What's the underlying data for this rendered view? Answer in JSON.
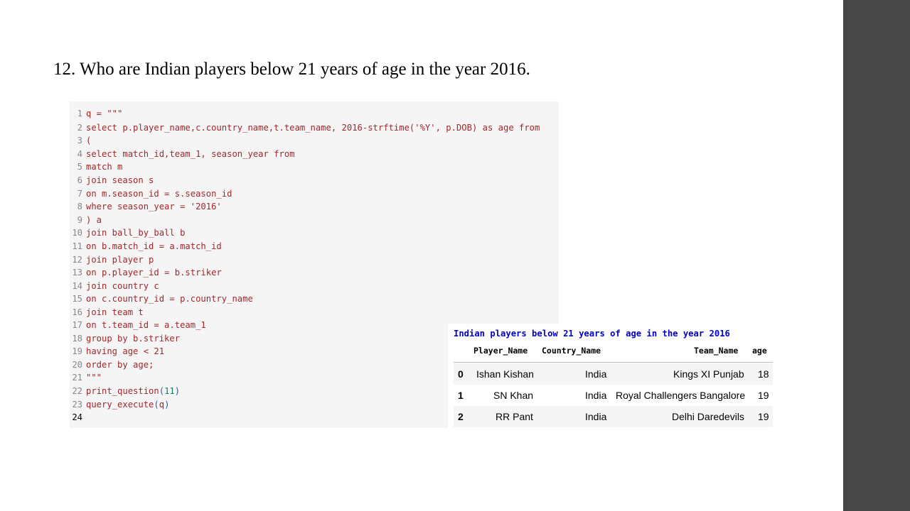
{
  "slide": {
    "title": "12. Who are Indian players below 21 years of age in the year 2016."
  },
  "code": {
    "line_numbers": [
      "1",
      "2",
      "3",
      "4",
      "5",
      "6",
      "7",
      "8",
      "9",
      "10",
      "11",
      "12",
      "13",
      "14",
      "15",
      "16",
      "17",
      "18",
      "19",
      "20",
      "21",
      "22",
      "23",
      "24"
    ],
    "lines": [
      "q = \"\"\"",
      "select p.player_name,c.country_name,t.team_name, 2016-strftime('%Y', p.DOB) as age from",
      "(",
      "select match_id,team_1, season_year from",
      "match m",
      "join season s",
      "on m.season_id = s.season_id",
      "where season_year = '2016'",
      ") a",
      "join ball_by_ball b",
      "on b.match_id = a.match_id",
      "join player p",
      "on p.player_id = b.striker",
      "join country c",
      "on c.country_id = p.country_name",
      "join team t",
      "on t.team_id = a.team_1",
      "group by b.striker",
      "having age < 21",
      "order by age;",
      "\"\"\"",
      "",
      "",
      ""
    ],
    "line22": {
      "fn": "print_question",
      "open": "(",
      "arg": "11",
      "close": ")"
    },
    "line23": {
      "fn": "query_execute",
      "open": "(",
      "arg": "q",
      "close": ")"
    }
  },
  "result": {
    "title": "Indian players below 21 years of age in the year 2016",
    "headers": {
      "player_name": "Player_Name",
      "country_name": "Country_Name",
      "team_name": "Team_Name",
      "age": "age"
    },
    "rows": [
      {
        "index": "0",
        "player_name": "Ishan Kishan",
        "country_name": "India",
        "team_name": "Kings XI Punjab",
        "age": "18"
      },
      {
        "index": "1",
        "player_name": "SN Khan",
        "country_name": "India",
        "team_name": "Royal Challengers Bangalore",
        "age": "19"
      },
      {
        "index": "2",
        "player_name": "RR Pant",
        "country_name": "India",
        "team_name": "Delhi Daredevils",
        "age": "19"
      }
    ]
  },
  "colors": {
    "code_text": "#a0282c",
    "code_call": "#2a55b5",
    "code_number": "#098658",
    "result_title": "#0000cc",
    "side_bar": "#474747"
  }
}
